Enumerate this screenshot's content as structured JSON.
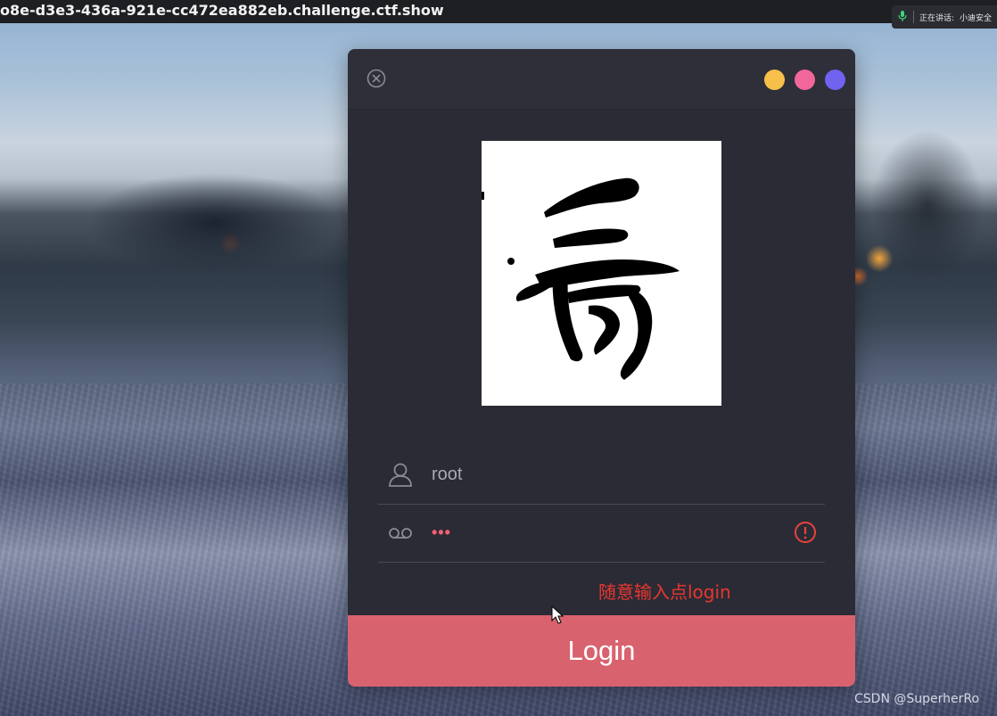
{
  "browser": {
    "url_fragment": "o8e-d3e3-436a-921e-cc472ea882eb.challenge.ctf.show"
  },
  "meeting_bar": {
    "status": "正在讲话:",
    "speaker": "小迪安全"
  },
  "dialog": {
    "window_dots": [
      "#f7c04a",
      "#f2679a",
      "#6f63f0"
    ],
    "image_alt": "秀",
    "username": {
      "value": "root",
      "icon": "user-icon"
    },
    "password": {
      "value": "•••",
      "icon": "voicemail-key-icon",
      "status_icon": "warning-circle-icon"
    },
    "annotation": "随意输入点login",
    "login_label": "Login"
  },
  "watermark": "CSDN @SuperherRo",
  "colors": {
    "dialog_bg": "#2b2b35",
    "login_button": "#d9626f",
    "error": "#e8362f"
  }
}
